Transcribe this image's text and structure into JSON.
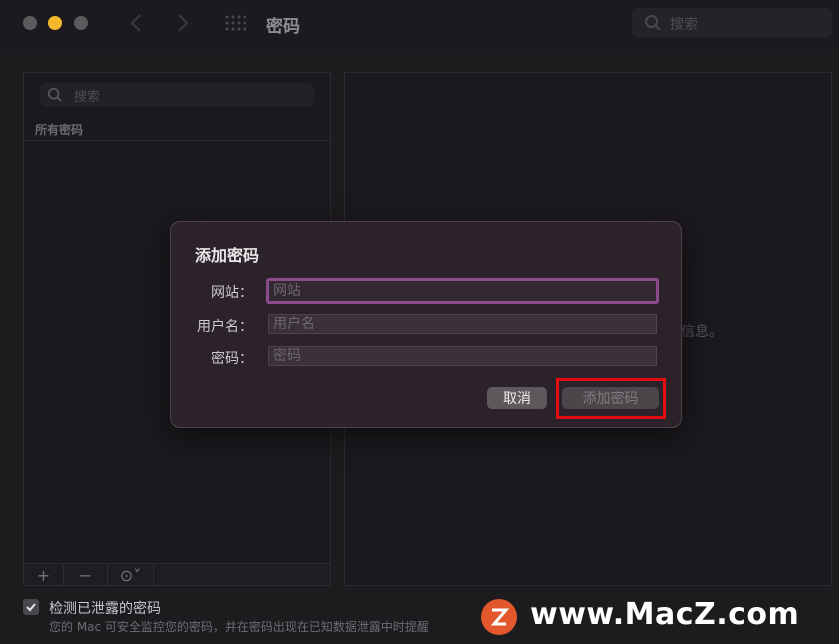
{
  "window": {
    "title": "密码",
    "search_placeholder": "搜索"
  },
  "sidebar": {
    "search_placeholder": "搜索",
    "list_header": "所有密码",
    "toolbar": {
      "add": "+",
      "remove": "−",
      "more": "⊙˅"
    }
  },
  "detail": {
    "hint": "信息。"
  },
  "dialog": {
    "title": "添加密码",
    "website_label": "网站：",
    "website_placeholder": "网站",
    "username_label": "用户名：",
    "username_placeholder": "用户名",
    "password_label": "密码：",
    "password_placeholder": "密码",
    "cancel_button": "取消",
    "add_button": "添加密码"
  },
  "footer": {
    "detect_label": "检测已泄露的密码",
    "detect_checked": true,
    "detect_desc": "您的 Mac 可安全监控您的密码，并在密码出现在已知数据泄露中时提醒"
  },
  "watermark": {
    "text": "www.MacZ.com",
    "logo_letter": "Z"
  },
  "colors": {
    "highlight": "#e30c12",
    "focus_ring": "#8a4c8c",
    "minimize": "#f3b82b"
  }
}
